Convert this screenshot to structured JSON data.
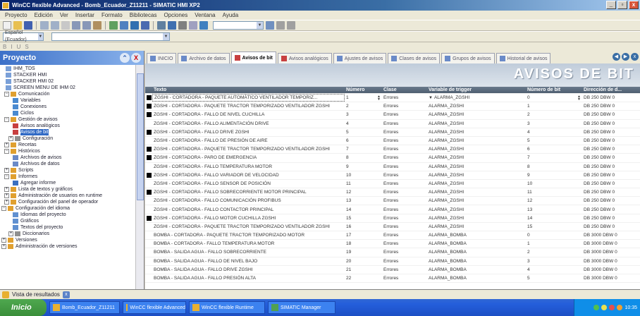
{
  "window": {
    "title": "WinCC flexible Advanced - Bomb_Ecuador_Z11211 - SIMATIC HMI XP2",
    "minimize": "_",
    "maximize": "▫",
    "close": "x"
  },
  "menubar": [
    "Proyecto",
    "Edición",
    "Ver",
    "Insertar",
    "Formato",
    "Bibliotecas",
    "Opciones",
    "Ventana",
    "Ayuda"
  ],
  "toolbar": {
    "combo_label": "Español (Ecuador)",
    "combo_arrow": "▼"
  },
  "toolbar3": [
    "B",
    "I",
    "U",
    "S"
  ],
  "project": {
    "header": "Proyecto",
    "btn_pin": "⌃",
    "btn_close": "X",
    "tree": [
      {
        "label": "IHM_TDS",
        "indent": 8,
        "exp": "",
        "icon": "#7aa0d8"
      },
      {
        "label": "STACKER HMI",
        "indent": 8,
        "exp": "",
        "icon": "#7aa0d8"
      },
      {
        "label": "STACKER HMI 02",
        "indent": 8,
        "exp": "",
        "icon": "#7aa0d8"
      },
      {
        "label": "SCREEN MENU DE IHM 02",
        "indent": 8,
        "exp": "",
        "icon": "#7aa0d8"
      },
      {
        "label": "Comunicación",
        "indent": 6,
        "exp": "−",
        "icon": "#e0a030"
      },
      {
        "label": "Variables",
        "indent": 18,
        "exp": "",
        "icon": "#4a8ad0"
      },
      {
        "label": "Conexiones",
        "indent": 18,
        "exp": "",
        "icon": "#4a8ad0"
      },
      {
        "label": "Ciclos",
        "indent": 18,
        "exp": "",
        "icon": "#4a8ad0"
      },
      {
        "label": "Gestión de avisos",
        "indent": 6,
        "exp": "−",
        "icon": "#e0a030"
      },
      {
        "label": "Avisos analógicos",
        "indent": 18,
        "exp": "",
        "icon": "#c84040"
      },
      {
        "label": "Avisos de bit",
        "indent": 18,
        "exp": "",
        "icon": "#c84040",
        "selected": true
      },
      {
        "label": "Configuración",
        "indent": 12,
        "exp": "+",
        "icon": "#909090"
      },
      {
        "label": "Recetas",
        "indent": 6,
        "exp": "+",
        "icon": "#e0a030"
      },
      {
        "label": "Históricos",
        "indent": 6,
        "exp": "−",
        "icon": "#e0a030"
      },
      {
        "label": "Archivos de avisos",
        "indent": 18,
        "exp": "",
        "icon": "#6a8ac8"
      },
      {
        "label": "Archivos de datos",
        "indent": 18,
        "exp": "",
        "icon": "#6a8ac8"
      },
      {
        "label": "Scripts",
        "indent": 6,
        "exp": "+",
        "icon": "#e0a030"
      },
      {
        "label": "Informes",
        "indent": 6,
        "exp": "−",
        "icon": "#e0a030"
      },
      {
        "label": "Agregar informe",
        "indent": 18,
        "exp": "",
        "icon": "#3a70c0"
      },
      {
        "label": "Lista de textos y gráficos",
        "indent": 6,
        "exp": "+",
        "icon": "#e0a030"
      },
      {
        "label": "Administración de usuarios en runtime",
        "indent": 6,
        "exp": "+",
        "icon": "#e0a030"
      },
      {
        "label": "Configuración del panel de operador",
        "indent": 6,
        "exp": "+",
        "icon": "#e0a030"
      },
      {
        "label": "Configuración del idioma",
        "indent": 2,
        "exp": "−",
        "icon": "#e0a030"
      },
      {
        "label": "Idiomas del proyecto",
        "indent": 18,
        "exp": "",
        "icon": "#6090d0"
      },
      {
        "label": "Gráficos",
        "indent": 18,
        "exp": "",
        "icon": "#6090d0"
      },
      {
        "label": "Textos del proyecto",
        "indent": 18,
        "exp": "",
        "icon": "#6090d0"
      },
      {
        "label": "Diccionarios",
        "indent": 12,
        "exp": "+",
        "icon": "#909090"
      },
      {
        "label": "Versiones",
        "indent": 2,
        "exp": "+",
        "icon": "#e0a030"
      },
      {
        "label": "Administración de versiones",
        "indent": 2,
        "exp": "+",
        "icon": "#e0a030"
      }
    ]
  },
  "tabs": [
    {
      "label": "INICIO",
      "icon": "#6a8ac8",
      "active": false
    },
    {
      "label": "Archivo de datos",
      "icon": "#6a8ac8",
      "active": false
    },
    {
      "label": "Avisos de bit",
      "icon": "#c84040",
      "active": true
    },
    {
      "label": "Avisos analógicos",
      "icon": "#c84040",
      "active": false
    },
    {
      "label": "Ajustes de avisos",
      "icon": "#6a8ac8",
      "active": false
    },
    {
      "label": "Clases de avisos",
      "icon": "#6a8ac8",
      "active": false
    },
    {
      "label": "Grupos de avisos",
      "icon": "#6a8ac8",
      "active": false
    },
    {
      "label": "Historial de avisos",
      "icon": "#6a8ac8",
      "active": false
    }
  ],
  "tab_nav": {
    "prev": "◀",
    "next": "▶",
    "close": "x"
  },
  "banner_title": "AVISOS DE BIT",
  "grid": {
    "headers": [
      "Texto",
      "Número",
      "Clase",
      "Variable de trigger",
      "Número de bit",
      "Dirección de d..."
    ],
    "rows": [
      {
        "mark": true,
        "text": "ZGSHI - CORTADORA - PAQUETE AUTOMÁTICO VENTILADOR TEMPORIZ...",
        "num": "1",
        "cls": "Errores",
        "var": "ALARMA_ZGSHI",
        "bit": "0",
        "addr": "DB 250 DBW 0",
        "edit": true
      },
      {
        "mark": true,
        "text": "ZGSHI - CORTADORA - PAQUETE TRACTOR TEMPORIZADO VENTILADOR ZGSHI",
        "num": "2",
        "cls": "Errores",
        "var": "ALARMA_ZGSHI",
        "bit": "1",
        "addr": "DB 250 DBW 0"
      },
      {
        "mark": true,
        "text": "ZGSHI - CORTADORA - FALLO DE NIVEL CUCHILLA",
        "num": "3",
        "cls": "Errores",
        "var": "ALARMA_ZGSHI",
        "bit": "2",
        "addr": "DB 250 DBW 0"
      },
      {
        "mark": false,
        "text": "ZGSHI - CORTADORA - FALLO ALIMENTACIÓN DRIVE",
        "num": "4",
        "cls": "Errores",
        "var": "ALARMA_ZGSHI",
        "bit": "3",
        "addr": "DB 250 DBW 0"
      },
      {
        "mark": true,
        "text": "ZGSHI - CORTADORA - FALLO DRIVE ZGSHI",
        "num": "5",
        "cls": "Errores",
        "var": "ALARMA_ZGSHI",
        "bit": "4",
        "addr": "DB 250 DBW 0"
      },
      {
        "mark": false,
        "text": "ZGSHI - CORTADORA - FALLO DE PRESIÓN DE AIRE",
        "num": "6",
        "cls": "Errores",
        "var": "ALARMA_ZGSHI",
        "bit": "5",
        "addr": "DB 250 DBW 0"
      },
      {
        "mark": true,
        "text": "ZGSHI - CORTADORA - PAQUETE TRACTOR TEMPORIZADO VENTILADOR ZGSHI",
        "num": "7",
        "cls": "Errores",
        "var": "ALARMA_ZGSHI",
        "bit": "6",
        "addr": "DB 250 DBW 0"
      },
      {
        "mark": true,
        "text": "ZGSHI - CORTADORA - PARO DE EMERGENCIA",
        "num": "8",
        "cls": "Errores",
        "var": "ALARMA_ZGSHI",
        "bit": "7",
        "addr": "DB 250 DBW 0"
      },
      {
        "mark": false,
        "text": "ZGSHI - CORTADORA - FALLO TEMPERATURA MOTOR",
        "num": "9",
        "cls": "Errores",
        "var": "ALARMA_ZGSHI",
        "bit": "8",
        "addr": "DB 250 DBW 0"
      },
      {
        "mark": true,
        "text": "ZGSHI - CORTADORA - FALLO VARIADOR DE VELOCIDAD",
        "num": "10",
        "cls": "Errores",
        "var": "ALARMA_ZGSHI",
        "bit": "9",
        "addr": "DB 250 DBW 0"
      },
      {
        "mark": false,
        "text": "ZGSHI - CORTADORA - FALLO SENSOR DE POSICIÓN",
        "num": "11",
        "cls": "Errores",
        "var": "ALARMA_ZGSHI",
        "bit": "10",
        "addr": "DB 250 DBW 0"
      },
      {
        "mark": true,
        "text": "ZGSHI - CORTADORA - FALLO SOBRECORRIENTE MOTOR PRINCIPAL",
        "num": "12",
        "cls": "Errores",
        "var": "ALARMA_ZGSHI",
        "bit": "11",
        "addr": "DB 250 DBW 0"
      },
      {
        "mark": false,
        "text": "ZGSHI - CORTADORA - FALLO COMUNICACIÓN PROFIBUS",
        "num": "13",
        "cls": "Errores",
        "var": "ALARMA_ZGSHI",
        "bit": "12",
        "addr": "DB 250 DBW 0"
      },
      {
        "mark": false,
        "text": "ZGSHI - CORTADORA - FALLO CONTACTOR PRINCIPAL",
        "num": "14",
        "cls": "Errores",
        "var": "ALARMA_ZGSHI",
        "bit": "13",
        "addr": "DB 250 DBW 0"
      },
      {
        "mark": true,
        "text": "ZGSHI - CORTADORA - FALLO MOTOR CUCHILLA ZGSHI",
        "num": "15",
        "cls": "Errores",
        "var": "ALARMA_ZGSHI",
        "bit": "14",
        "addr": "DB 250 DBW 0"
      },
      {
        "mark": false,
        "text": "ZGSHI - CORTADORA - PAQUETE TRACTOR TEMPORIZADO VENTILADOR ZGSHI",
        "num": "16",
        "cls": "Errores",
        "var": "ALARMA_ZGSHI",
        "bit": "15",
        "addr": "DB 250 DBW 0"
      },
      {
        "mark": false,
        "text": "BOMBA - CORTADORA - PAQUETE TRACTOR TEMPORIZADO MOTOR",
        "num": "17",
        "cls": "Errores",
        "var": "ALARMA_BOMBA",
        "bit": "0",
        "addr": "DB 3000 DBW 0"
      },
      {
        "mark": false,
        "text": "BOMBA - CORTADORA - FALLO TEMPERATURA MOTOR",
        "num": "18",
        "cls": "Errores",
        "var": "ALARMA_BOMBA",
        "bit": "1",
        "addr": "DB 3000 DBW 0"
      },
      {
        "mark": false,
        "text": "BOMBA - SALIDA AGUA - FALLO SOBRECORRIENTE",
        "num": "19",
        "cls": "Errores",
        "var": "ALARMA_BOMBA",
        "bit": "2",
        "addr": "DB 3000 DBW 0"
      },
      {
        "mark": false,
        "text": "BOMBA - SALIDA AGUA - FALLO DE NIVEL BAJO",
        "num": "20",
        "cls": "Errores",
        "var": "ALARMA_BOMBA",
        "bit": "3",
        "addr": "DB 3000 DBW 0"
      },
      {
        "mark": false,
        "text": "BOMBA - SALIDA AGUA - FALLO DRIVE ZGSHI",
        "num": "21",
        "cls": "Errores",
        "var": "ALARMA_BOMBA",
        "bit": "4",
        "addr": "DB 3000 DBW 0"
      },
      {
        "mark": false,
        "text": "BOMBA - SALIDA AGUA - FALLO PRESIÓN ALTA",
        "num": "22",
        "cls": "Errores",
        "var": "ALARMA_BOMBA",
        "bit": "5",
        "addr": "DB 3000 DBW 0"
      }
    ]
  },
  "results": {
    "label": "Vista de resultados",
    "close": "x"
  },
  "taskbar": {
    "start": "Inicio",
    "tasks": [
      {
        "label": "Bomb_Ecuador_Z11211",
        "icon": "#e8b030",
        "w": 100
      },
      {
        "label": "WinCC flexible Advanced",
        "icon": "#e8b030",
        "w": 90
      },
      {
        "label": "WinCC flexible Runtime",
        "icon": "#e8b030",
        "w": 108
      },
      {
        "label": "SIMATIC Manager",
        "icon": "#50a050",
        "w": 96
      }
    ],
    "clock": "10:35"
  }
}
